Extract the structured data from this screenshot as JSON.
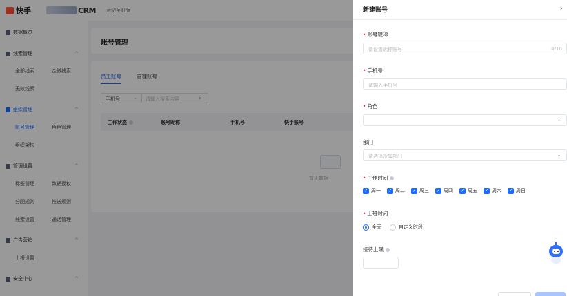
{
  "topbar": {
    "logo_text": "快手",
    "crm_text": "CRM",
    "switch_label": "⇄切至旧版"
  },
  "sidebar": {
    "groups": [
      {
        "label": "数据概览"
      },
      {
        "label": "线索管理"
      },
      {
        "label": "组织管理"
      },
      {
        "label": "管理设置"
      },
      {
        "label": "广告营销"
      },
      {
        "label": "安全中心"
      }
    ],
    "items": {
      "all_leads": "全部线索",
      "wechat_leads": "企微线索",
      "invalid_leads": "无效线索",
      "account_mgmt": "账号管理",
      "role_mgmt": "角色管理",
      "org_structure": "组织架构",
      "tag_mgmt": "标签管理",
      "data_auth": "数据授权",
      "assign_rules": "分配规则",
      "push_rules": "推送规则",
      "lead_settings": "线索设置",
      "call_mgmt": "通话管理",
      "report_settings": "上报设置"
    }
  },
  "main": {
    "title": "账号管理",
    "tabs": [
      "员工账号",
      "管理账号"
    ],
    "filter_select": "手机号",
    "filter_placeholder": "请输入搜索内容",
    "columns": [
      "工作状态",
      "账号昵称",
      "手机号",
      "快手账号"
    ],
    "empty_text": "暂无数据"
  },
  "drawer": {
    "title": "新建账号",
    "close_icon": "›",
    "nickname_label": "账号昵称",
    "nickname_placeholder": "请设置昵称账号",
    "nickname_count": "0/10",
    "phone_label": "手机号",
    "phone_placeholder": "请输入手机号",
    "role_label": "角色",
    "dept_label": "部门",
    "dept_placeholder": "请选择所属部门",
    "worktime_label": "工作时间",
    "weekdays": [
      "周一",
      "周二",
      "周三",
      "周四",
      "周五",
      "周六",
      "周日"
    ],
    "shift_label": "上班时间",
    "shift_options": [
      "全天",
      "自定义时段"
    ],
    "limit_label": "接待上限"
  },
  "colors": {
    "accent": "#1f6bff",
    "required": "#f5222d"
  }
}
